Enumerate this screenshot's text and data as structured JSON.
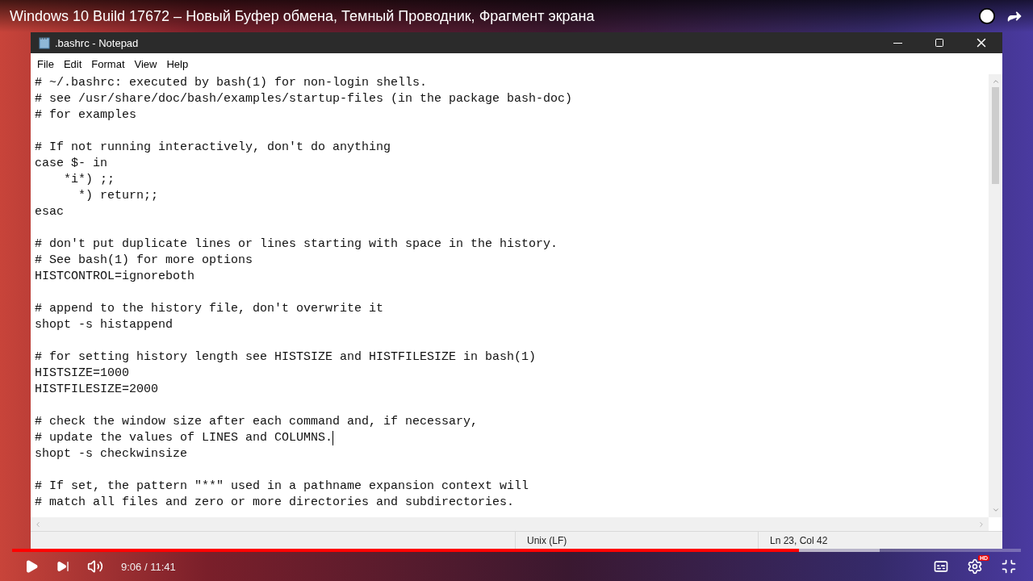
{
  "video": {
    "title": "Windows 10 Build 17672 – Новый Буфер обмена, Темный Проводник, Фрагмент экрана",
    "time": "9:06 / 11:41",
    "progress": {
      "level": 0.78
    },
    "buffered": {
      "level": 0.86
    },
    "quality_badge": "HD"
  },
  "notepad": {
    "title": ".bashrc - Notepad",
    "menu": [
      "File",
      "Edit",
      "Format",
      "View",
      "Help"
    ],
    "blocks": [
      [
        {
          "text": "# ~/.bashrc: executed by bash(1) for non-login shells.",
          "caret": false
        },
        {
          "text": "# see /usr/share/doc/bash/examples/startup-files (in the package bash-doc)",
          "caret": false
        },
        {
          "text": "# for examples",
          "caret": false
        }
      ],
      [
        {
          "text": "# If not running interactively, don't do anything",
          "caret": false
        },
        {
          "text": "case $- in",
          "caret": false
        },
        {
          "text": "    *i*) ;;",
          "caret": false
        },
        {
          "text": "      *) return;;",
          "caret": false
        },
        {
          "text": "esac",
          "caret": false
        }
      ],
      [
        {
          "text": "# don't put duplicate lines or lines starting with space in the history.",
          "caret": false
        },
        {
          "text": "# See bash(1) for more options",
          "caret": false
        },
        {
          "text": "HISTCONTROL=ignoreboth",
          "caret": false
        }
      ],
      [
        {
          "text": "# append to the history file, don't overwrite it",
          "caret": false
        },
        {
          "text": "shopt -s histappend",
          "caret": false
        }
      ],
      [
        {
          "text": "# for setting history length see HISTSIZE and HISTFILESIZE in bash(1)",
          "caret": false
        },
        {
          "text": "HISTSIZE=1000",
          "caret": false
        },
        {
          "text": "HISTFILESIZE=2000",
          "caret": false
        }
      ],
      [
        {
          "text": "# check the window size after each command and, if necessary,",
          "caret": false
        },
        {
          "text": "# update the values of LINES and COLUMNS.",
          "caret": true
        },
        {
          "text": "shopt -s checkwinsize",
          "caret": false
        }
      ],
      [
        {
          "text": "# If set, the pattern \"**\" used in a pathname expansion context will",
          "caret": false
        },
        {
          "text": "# match all files and zero or more directories and subdirectories.",
          "caret": false
        }
      ]
    ],
    "status": [
      "Unix (LF)",
      "Ln 23, Col 42"
    ]
  }
}
